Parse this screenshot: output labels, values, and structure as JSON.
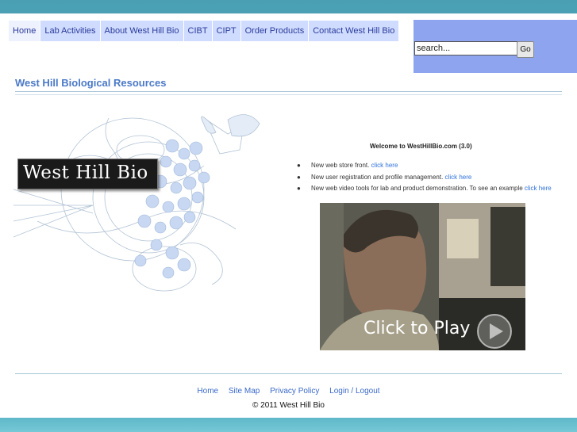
{
  "nav": {
    "items": [
      {
        "label": "Home"
      },
      {
        "label": "Lab Activities"
      },
      {
        "label": "About West Hill Bio"
      },
      {
        "label": "CIBT"
      },
      {
        "label": "CIPT"
      },
      {
        "label": "Order Products"
      },
      {
        "label": "Contact West Hill Bio"
      }
    ],
    "active_index": 0
  },
  "search": {
    "value": "search...",
    "button_label": "Go"
  },
  "page": {
    "title": "West Hill Biological Resources"
  },
  "hero": {
    "logo_text": "West Hill Bio"
  },
  "welcome": {
    "heading": "Welcome to WestHillBio.com (3.0)",
    "bullets": [
      {
        "text": "New web store front. ",
        "link": "click here"
      },
      {
        "text": "New user registration and profile management. ",
        "link": "click here"
      },
      {
        "text": "New web video tools for lab and product demonstration. To see an example ",
        "link": "click here"
      }
    ]
  },
  "video": {
    "overlay_text": "Click to Play"
  },
  "footer": {
    "links": [
      "Home",
      "Site Map",
      "Privacy Policy",
      "Login / Logout"
    ],
    "copyright": "© 2011 West Hill Bio"
  },
  "colors": {
    "accent": "#4a79c8",
    "nav_bg": "#cfdcff",
    "search_panel": "#8fa4ee",
    "link": "#2f73d8",
    "outer_bg": "#5bb3c5"
  }
}
